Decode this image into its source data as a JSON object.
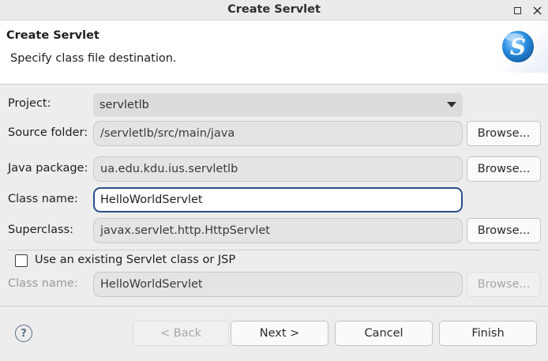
{
  "window": {
    "title": "Create Servlet"
  },
  "header": {
    "title": "Create Servlet",
    "description": "Specify class file destination."
  },
  "form": {
    "project": {
      "label": "Project:",
      "value": "servletlb"
    },
    "source_folder": {
      "label": "Source folder:",
      "value": "/servletlb/src/main/java",
      "browse_label": "Browse..."
    },
    "java_package": {
      "label": "Java package:",
      "value": "ua.edu.kdu.ius.servletlb",
      "browse_label": "Browse..."
    },
    "class_name": {
      "label": "Class name:",
      "value": "HelloWorldServlet"
    },
    "superclass": {
      "label": "Superclass:",
      "value": "javax.servlet.http.HttpServlet",
      "browse_label": "Browse..."
    },
    "use_existing": {
      "label": "Use an existing Servlet class or JSP",
      "checked": false
    },
    "existing_class_name": {
      "label": "Class name:",
      "value": "HelloWorldServlet",
      "browse_label": "Browse..."
    }
  },
  "footer": {
    "help_symbol": "?",
    "back_label": "< Back",
    "next_label": "Next >",
    "cancel_label": "Cancel",
    "finish_label": "Finish"
  },
  "colors": {
    "accent_focus": "#2b4f8a",
    "logo_blue": "#1f86d6"
  },
  "icons": {
    "logo": "servlet-logo-icon",
    "help": "help-icon",
    "dropdown": "chevron-down-icon"
  }
}
